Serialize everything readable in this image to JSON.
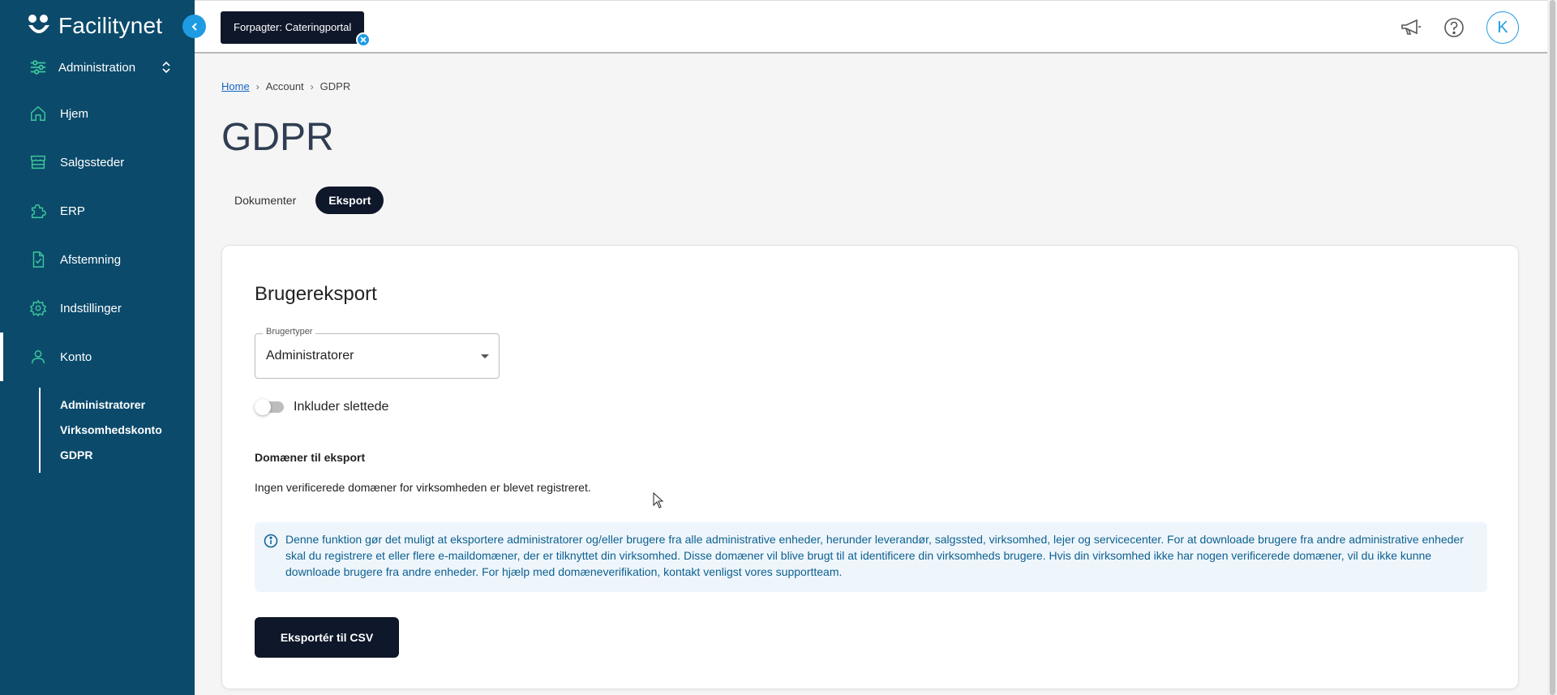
{
  "brand": {
    "name": "Facilitynet"
  },
  "sidebar": {
    "admin_label": "Administration",
    "items": [
      {
        "label": "Hjem",
        "icon": "home-icon"
      },
      {
        "label": "Salgssteder",
        "icon": "store-icon"
      },
      {
        "label": "ERP",
        "icon": "puzzle-icon"
      },
      {
        "label": "Afstemning",
        "icon": "document-check-icon"
      },
      {
        "label": "Indstillinger",
        "icon": "gear-icon"
      },
      {
        "label": "Konto",
        "icon": "user-icon"
      }
    ],
    "subitems": [
      {
        "label": "Administratorer"
      },
      {
        "label": "Virksomhedskonto"
      },
      {
        "label": "GDPR"
      }
    ]
  },
  "topbar": {
    "tenant_chip": "Forpagter: Cateringportal",
    "avatar_initial": "K"
  },
  "breadcrumb": {
    "home": "Home",
    "account": "Account",
    "current": "GDPR"
  },
  "page": {
    "title": "GDPR"
  },
  "tabs": [
    {
      "label": "Dokumenter"
    },
    {
      "label": "Eksport"
    }
  ],
  "card": {
    "title": "Brugereksport",
    "select": {
      "label": "Brugertyper",
      "value": "Administratorer"
    },
    "toggle_label": "Inkluder slettede",
    "domains_title": "Domæner til eksport",
    "domains_text": "Ingen verificerede domæner for virksomheden er blevet registreret.",
    "info_text": "Denne funktion gør det muligt at eksportere administratorer og/eller brugere fra alle administrative enheder, herunder leverandør, salgssted, virksomhed, lejer og servicecenter. For at downloade brugere fra andre administrative enheder skal du registrere et eller flere e-maildomæner, der er tilknyttet din virksomhed. Disse domæner vil blive brugt til at identificere din virksomheds brugere. Hvis din virksomhed ikke har nogen verificerede domæner, vil du ikke kunne downloade brugere fra andre enheder. For hjælp med domæneverifikation, kontakt venligst vores supportteam.",
    "export_button": "Eksportér til CSV"
  },
  "colors": {
    "sidebar_bg": "#0b4a6b",
    "accent": "#1e9be3",
    "dark": "#0f172a",
    "info_bg": "#eef6fc",
    "info_text": "#0d5f8f",
    "nav_icon": "#3cc79a"
  }
}
